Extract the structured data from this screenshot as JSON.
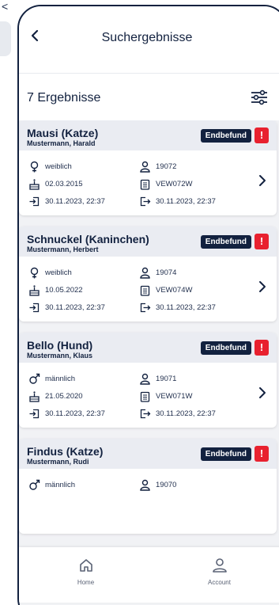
{
  "background": {
    "back_glyph": "<"
  },
  "header": {
    "back_icon": "chevron-left-icon",
    "title": "Suchergebnisse"
  },
  "results": {
    "count_label": "7 Ergebnisse",
    "filter_icon": "sliders-icon"
  },
  "badge_text": "Endbefund",
  "alert_text": "!",
  "cards": [
    {
      "name": "Mausi (Katze)",
      "owner": "Mustermann, Harald",
      "sex": "weiblich",
      "sex_icon": "female-icon",
      "id": "19072",
      "birth": "02.03.2015",
      "code": "VEW072W",
      "in": "30.11.2023, 22:37",
      "out": "30.11.2023, 22:37"
    },
    {
      "name": "Schnuckel (Kaninchen)",
      "owner": "Mustermann, Herbert",
      "sex": "weiblich",
      "sex_icon": "female-icon",
      "id": "19074",
      "birth": "10.05.2022",
      "code": "VEW074W",
      "in": "30.11.2023, 22:37",
      "out": "30.11.2023, 22:37"
    },
    {
      "name": "Bello (Hund)",
      "owner": "Mustermann, Klaus",
      "sex": "männlich",
      "sex_icon": "male-icon",
      "id": "19071",
      "birth": "21.05.2020",
      "code": "VEW071W",
      "in": "30.11.2023, 22:37",
      "out": "30.11.2023, 22:37"
    },
    {
      "name": "Findus (Katze)",
      "owner": "Mustermann, Rudi",
      "sex": "männlich",
      "sex_icon": "male-icon",
      "id": "19070"
    }
  ],
  "nav": [
    {
      "label": "Home",
      "icon": "home-icon"
    },
    {
      "label": "Account",
      "icon": "account-icon"
    }
  ],
  "colors": {
    "navy": "#12213f",
    "alert_red": "#e8212f",
    "card_head_bg": "#eaecf2",
    "screen_bg": "#f1f2f5"
  }
}
